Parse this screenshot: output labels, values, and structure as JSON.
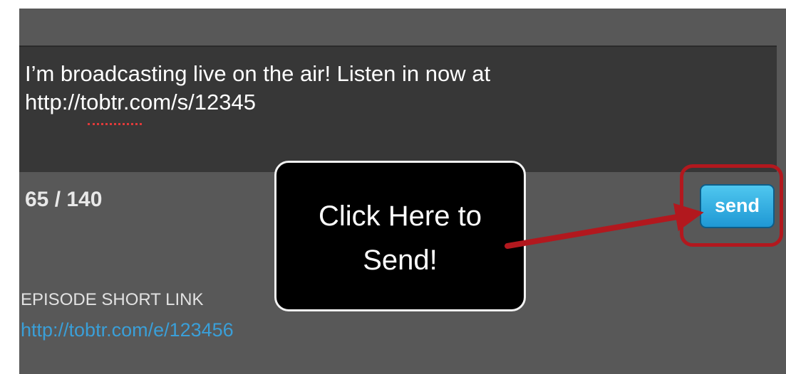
{
  "message": {
    "text": "I’m broadcasting live on the air! Listen in now at\nhttp://tobtr.com/s/12345"
  },
  "char_count": "65 / 140",
  "send_button": {
    "label": "send"
  },
  "callout": {
    "text": "Click Here to\nSend!"
  },
  "episode": {
    "label": "EPISODE SHORT LINK",
    "link": "http://tobtr.com/e/123456"
  },
  "colors": {
    "panel_bg": "#585858",
    "textarea_bg": "#373737",
    "highlight_red": "#b2181e",
    "send_blue": "#2aa6df",
    "link_blue": "#3a9fd8"
  }
}
